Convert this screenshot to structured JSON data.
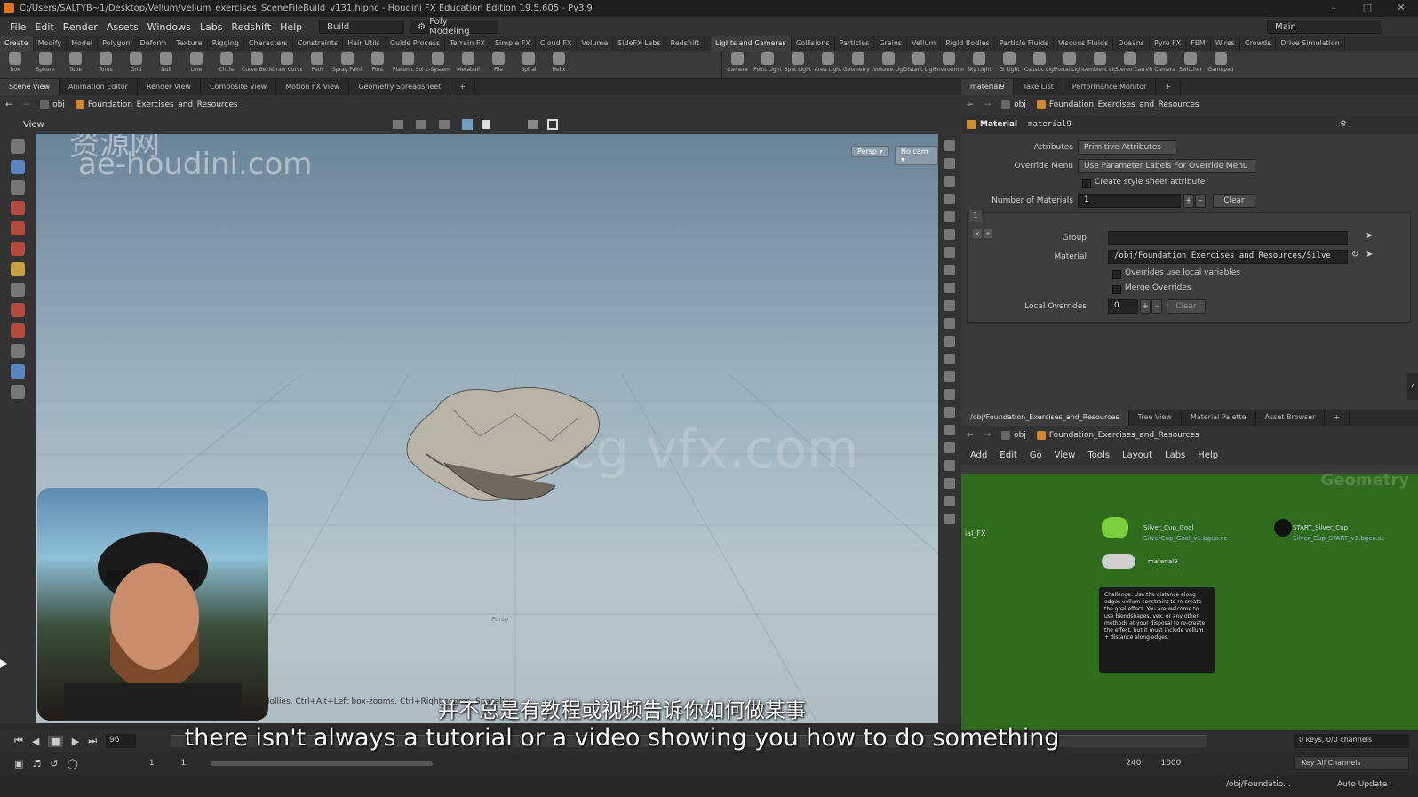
{
  "window": {
    "title": "C:/Users/SALTYB~1/Desktop/Vellum/vellum_exercises_SceneFileBuild_v131.hipnc - Houdini FX Education Edition 19.5.605 - Py3.9"
  },
  "menubar": {
    "items": [
      "File",
      "Edit",
      "Render",
      "Assets",
      "Windows",
      "Labs",
      "Redshift",
      "Help"
    ],
    "build": "Build",
    "desktop": "Poly Modeling",
    "main": "Main"
  },
  "shelf": {
    "tabs_left": [
      "Create",
      "Modify",
      "Model",
      "Polygon",
      "Deform",
      "Texture",
      "Rigging",
      "Characters",
      "Constraints",
      "Hair Utils",
      "Guide Process",
      "Terrain FX",
      "Simple FX",
      "Cloud FX",
      "Volume",
      "SideFX Labs",
      "Redshift"
    ],
    "tabs_right": [
      "Lights and Cameras",
      "Collisions",
      "Particles",
      "Grains",
      "Vellum",
      "Rigid Bodies",
      "Particle Fluids",
      "Viscous Fluids",
      "Oceans",
      "Pyro FX",
      "FEM",
      "Wires",
      "Crowds",
      "Drive Simulation"
    ],
    "tools_left": [
      "Box",
      "Sphere",
      "Tube",
      "Torus",
      "Grid",
      "Null",
      "Line",
      "Circle",
      "Curve Bezier",
      "Draw Curve",
      "Path",
      "Spray Paint",
      "Font",
      "Platonic Solids",
      "L-System",
      "Metaball",
      "File",
      "Spiral",
      "Helix"
    ],
    "tools_right": [
      "Camera",
      "Point Light",
      "Spot Light",
      "Area Light",
      "Geometry Light",
      "Volume Light",
      "Distant Light",
      "Environment Light",
      "Sky Light",
      "GI Light",
      "Caustic Light",
      "Portal Light",
      "Ambient Light",
      "Stereo Camera",
      "VR Camera",
      "Switcher",
      "Gamepad"
    ]
  },
  "left_pane": {
    "tabs": [
      "Scene View",
      "Animation Editor",
      "Render View",
      "Composite View",
      "Motion FX View",
      "Geometry Spreadsheet"
    ],
    "path_root": "obj",
    "path_node": "Foundation_Exercises_and_Resources",
    "view_label": "View",
    "persp": "Persp ▾",
    "cam": "No cam ▾",
    "watermark_cn": "资源网",
    "watermark_url": "ae-houdini.com",
    "watermark_center": "rrcg vfx.com",
    "hint": "ght dollies. Ctrl+Alt+Left box-zooms. Ctrl+Right zooms. Spacebar-",
    "floor_label": "Persp"
  },
  "parm_pane": {
    "tabs": [
      "material9",
      "Take List",
      "Performance Monitor"
    ],
    "path_root": "obj",
    "path_node": "Foundation_Exercises_and_Resources",
    "node_type": "Material",
    "node_name": "material9",
    "attributes_label": "Attributes",
    "attributes_value": "Primitive Attributes",
    "override_menu_label": "Override Menu",
    "override_menu_value": "Use Parameter Labels For Override Menu",
    "create_style_label": "Create style sheet attribute",
    "num_materials_label": "Number of Materials",
    "num_materials_value": "1",
    "clear_label": "Clear",
    "tab_index": "1",
    "group_label": "Group",
    "group_value": "",
    "material_label": "Material",
    "material_value": "/obj/Foundation_Exercises_and_Resources/Silve",
    "overrides_local_label": "Overrides use local variables",
    "merge_overrides_label": "Merge Overrides",
    "local_overrides_label": "Local Overrides",
    "local_overrides_value": "0",
    "clear2_label": "Clear"
  },
  "network_pane": {
    "tabs": [
      "/obj/Foundation_Exercises_and_Resources",
      "Tree View",
      "Material Palette",
      "Asset Browser"
    ],
    "path_root": "obj",
    "path_node": "Foundation_Exercises_and_Resources",
    "menu": [
      "Add",
      "Edit",
      "Go",
      "View",
      "Tools",
      "Layout",
      "Labs",
      "Help"
    ],
    "context_label": "Geometry",
    "left_label": "ial_FX",
    "node1": "Silver_Cup_Goal",
    "node1_sub": "SilverCup_Goal_v1.bgeo.sc",
    "node2": "START_Silver_Cup",
    "node2_sub": "Silver_Cup_START_v1.bgeo.sc",
    "node3": "material9",
    "sticky_note": "Challenge: Use the distance along edges vellum constraint to re-create the goal effect. You are welcome to use blendshapes, vex, or any other methods at your disposal to re-create the effect, but it must include vellum + distance along edges."
  },
  "timeline": {
    "frame": "96",
    "start": "1",
    "start2": "1",
    "end": "240",
    "end2": "1000",
    "keys": "0 keys, 0/0 channels",
    "key_all": "Key All Channels"
  },
  "status": {
    "path": "/obj/Foundatio...",
    "update": "Auto Update"
  },
  "subtitles": {
    "zh": "并不总是有教程或视频告诉你如何做某事",
    "en": "there isn't always a tutorial or a video showing you how to do something"
  },
  "colors": {
    "network_bg": "#2e6b1d",
    "viewport_top": "#6a8498",
    "accent": "#e8711a"
  }
}
